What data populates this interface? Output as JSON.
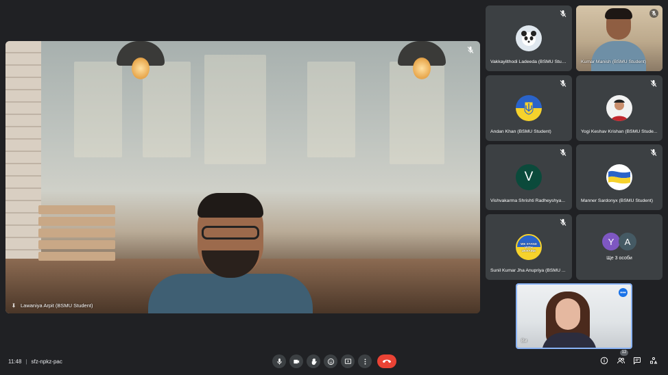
{
  "main_speaker": {
    "name": "Lawaniya Arpit (BSMU Student)"
  },
  "participants": [
    {
      "name": "Vakkayilthodi Ladeeda (BSMU Stud...",
      "avatar": "panda-avatar",
      "mic": "muted"
    },
    {
      "name": "Kumar Manish (BSMU Student)",
      "avatar": "video",
      "mic": "muted"
    },
    {
      "name": "Andan Khan (BSMU Student)",
      "avatar": "ukraine-coat-of-arms",
      "mic": "muted"
    },
    {
      "name": "Yogi Keshav Krishan (BSMU Stude...",
      "avatar": "photo-avatar",
      "mic": "muted"
    },
    {
      "name": "Vishvakarma Shrishti Radheyshya...",
      "avatar_letter": "V",
      "avatar_color": "#0b4a3b",
      "mic": "muted"
    },
    {
      "name": "Manner Sardonyx (BSMU Student)",
      "avatar": "ukraine-flag-wave",
      "mic": "muted"
    },
    {
      "name": "Sunil Kumar Jha Anupriya (BSMU ...",
      "avatar": "we-stand-with-ukraine",
      "avatar_text": "WE STAND WITH UKRAINE",
      "mic": "muted"
    }
  ],
  "others": {
    "letters": [
      "Y",
      "A"
    ],
    "colors": [
      "#7e57c2",
      "#455a64"
    ],
    "label": "Ще 3 особи"
  },
  "self_view": {
    "name": "Ви"
  },
  "bottom_bar": {
    "time": "11:48",
    "separator": "|",
    "meeting_code": "sfz-npkz-pac",
    "participants_count": "12"
  },
  "colors": {
    "background": "#202124",
    "tile": "#3c4043",
    "end_call": "#ea4335",
    "accent": "#8ab4f8"
  }
}
